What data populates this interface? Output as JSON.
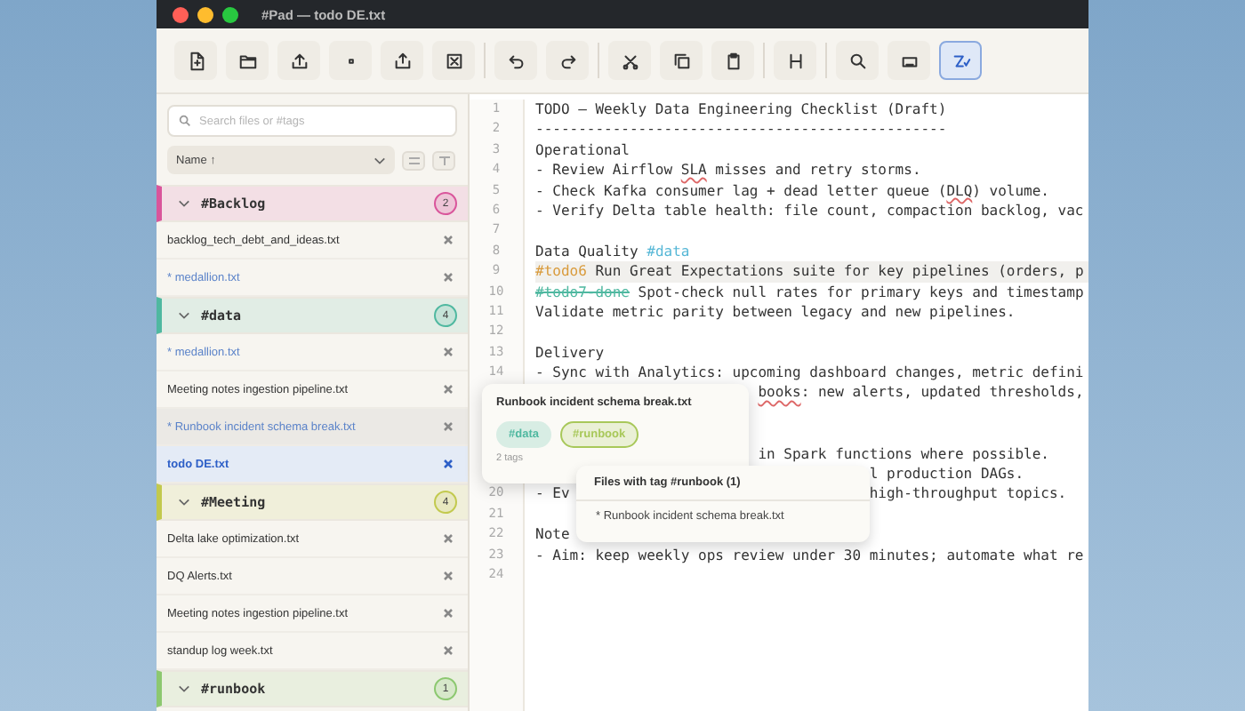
{
  "window": {
    "title": "#Pad — todo DE.txt"
  },
  "toolbar": [
    [
      {
        "kind": "new-file",
        "active": false
      },
      {
        "kind": "folder",
        "active": false
      },
      {
        "kind": "upload",
        "active": false
      },
      {
        "kind": "dot",
        "active": false
      },
      {
        "kind": "export",
        "active": false
      },
      {
        "kind": "close-box",
        "active": false
      }
    ],
    [
      {
        "kind": "undo",
        "active": false
      },
      {
        "kind": "redo",
        "active": false
      }
    ],
    [
      {
        "kind": "cut",
        "active": false
      },
      {
        "kind": "copy",
        "active": false
      },
      {
        "kind": "paste",
        "active": false
      }
    ],
    [
      {
        "kind": "heading",
        "active": false
      }
    ],
    [
      {
        "kind": "search",
        "active": false
      },
      {
        "kind": "keyboard",
        "active": false
      },
      {
        "kind": "wrap",
        "active": true
      }
    ]
  ],
  "sidebar": {
    "search": {
      "placeholder": "Search files or #tags"
    },
    "sort": "Name ↑",
    "groups": [
      {
        "name": "#Backlog",
        "count": "2",
        "color": "#d9559b",
        "expanded": true,
        "files": [
          {
            "name": "backlog_tech_debt_and_ideas.txt",
            "modified": false,
            "selected": false,
            "hovered": false
          },
          {
            "name": "* medallion.txt",
            "modified": true,
            "selected": false,
            "hovered": false
          }
        ]
      },
      {
        "name": "#data",
        "count": "4",
        "color": "#4fb8a0",
        "expanded": true,
        "files": [
          {
            "name": "* medallion.txt",
            "modified": true,
            "selected": false,
            "hovered": false
          },
          {
            "name": "Meeting notes ingestion pipeline.txt",
            "modified": false,
            "selected": false,
            "hovered": false
          },
          {
            "name": "* Runbook incident schema break.txt",
            "modified": true,
            "selected": false,
            "hovered": true
          },
          {
            "name": "todo DE.txt",
            "modified": false,
            "selected": true,
            "hovered": false
          }
        ]
      },
      {
        "name": "#Meeting",
        "count": "4",
        "color": "#c2c94e",
        "expanded": true,
        "files": [
          {
            "name": "Delta lake optimization.txt",
            "modified": false,
            "selected": false,
            "hovered": false
          },
          {
            "name": "DQ Alerts.txt",
            "modified": false,
            "selected": false,
            "hovered": false
          },
          {
            "name": "Meeting notes ingestion pipeline.txt",
            "modified": false,
            "selected": false,
            "hovered": false
          },
          {
            "name": "standup log week.txt",
            "modified": false,
            "selected": false,
            "hovered": false
          }
        ]
      },
      {
        "name": "#runbook",
        "count": "1",
        "color": "#8cc870",
        "expanded": true
      }
    ]
  },
  "editor": {
    "lines": [
      {
        "number": "1",
        "current": false,
        "spans": [
          {
            "kind": "plain",
            "text": "TODO — Weekly Data Engineering Checklist (Draft)"
          }
        ]
      },
      {
        "number": "2",
        "current": false,
        "spans": [
          {
            "kind": "plain",
            "text": "------------------------------------------------"
          }
        ]
      },
      {
        "number": "3",
        "current": false,
        "spans": [
          {
            "kind": "plain",
            "text": "Operational"
          }
        ]
      },
      {
        "number": "4",
        "current": false,
        "spans": [
          {
            "kind": "plain",
            "text": "- Review Airflow "
          },
          {
            "kind": "misspelled",
            "text": "SLA"
          },
          {
            "kind": "plain",
            "text": " misses and retry storms."
          }
        ]
      },
      {
        "number": "5",
        "current": false,
        "spans": [
          {
            "kind": "plain",
            "text": "- Check Kafka consumer lag + dead letter queue ("
          },
          {
            "kind": "misspelled",
            "text": "DLQ"
          },
          {
            "kind": "plain",
            "text": ") volume."
          }
        ]
      },
      {
        "number": "6",
        "current": false,
        "spans": [
          {
            "kind": "plain",
            "text": "- Verify Delta table health: file count, compaction backlog, vac"
          }
        ]
      },
      {
        "number": "7",
        "current": false
      },
      {
        "number": "8",
        "current": false,
        "spans": [
          {
            "kind": "plain",
            "text": "Data Quality "
          },
          {
            "kind": "tag",
            "text": "#data"
          }
        ]
      },
      {
        "number": "9",
        "current": true,
        "spans": [
          {
            "kind": "todo",
            "text": "#todo6"
          },
          {
            "kind": "plain",
            "text": " Run Great Expectations suite for key pipelines (orders, p"
          }
        ]
      },
      {
        "number": "10",
        "current": false,
        "spans": [
          {
            "kind": "done",
            "text": "#todo7-done"
          },
          {
            "kind": "plain",
            "text": " Spot-check null rates for primary keys and timestamp"
          }
        ]
      },
      {
        "number": "11",
        "current": false,
        "spans": [
          {
            "kind": "plain",
            "text": "Validate metric parity between legacy and new pipelines."
          }
        ]
      },
      {
        "number": "12",
        "current": false
      },
      {
        "number": "13",
        "current": false,
        "spans": [
          {
            "kind": "plain",
            "text": "Delivery"
          }
        ]
      },
      {
        "number": "14",
        "current": false,
        "spans": [
          {
            "kind": "plain",
            "text": "- Sync with Analytics: upcoming dashboard changes, metric defini"
          }
        ]
      },
      {
        "current": false,
        "tail": [
          {
            "kind": "misspelled",
            "text": "books"
          },
          {
            "kind": "plain",
            "text": ": new alerts, updated thresholds,"
          }
        ]
      },
      {
        "current": false
      },
      {
        "current": false
      },
      {
        "current": false,
        "tail": [
          {
            "kind": "plain",
            "text": "in Spark functions where possible."
          }
        ]
      },
      {
        "current": false,
        "tail": [
          {
            "kind": "plain",
            "text": "l production DAGs."
          }
        ]
      },
      {
        "number": "20",
        "current": false,
        "spans": [
          {
            "kind": "plain",
            "text": "- Ev"
          }
        ],
        "tail": [
          {
            "kind": "plain",
            "text": "high-throughput topics."
          }
        ]
      },
      {
        "number": "21",
        "current": false
      },
      {
        "number": "22",
        "current": false,
        "spans": [
          {
            "kind": "plain",
            "text": "Note"
          }
        ]
      },
      {
        "number": "23",
        "current": false,
        "spans": [
          {
            "kind": "plain",
            "text": "- Aim: keep weekly ops review under 30 minutes; automate what re"
          }
        ]
      },
      {
        "number": "24",
        "current": false
      }
    ]
  },
  "tag_popup": {
    "title": "Runbook incident schema break.txt",
    "tags": [
      {
        "label": "#data",
        "color": "#4fb8a0",
        "selected": false
      },
      {
        "label": "#runbook",
        "color": "#a8c85a",
        "selected": true
      }
    ],
    "count": "2 tags"
  },
  "files_popup": {
    "title": "Files with tag #runbook (1)",
    "files": [
      "* Runbook incident schema break.txt"
    ]
  }
}
